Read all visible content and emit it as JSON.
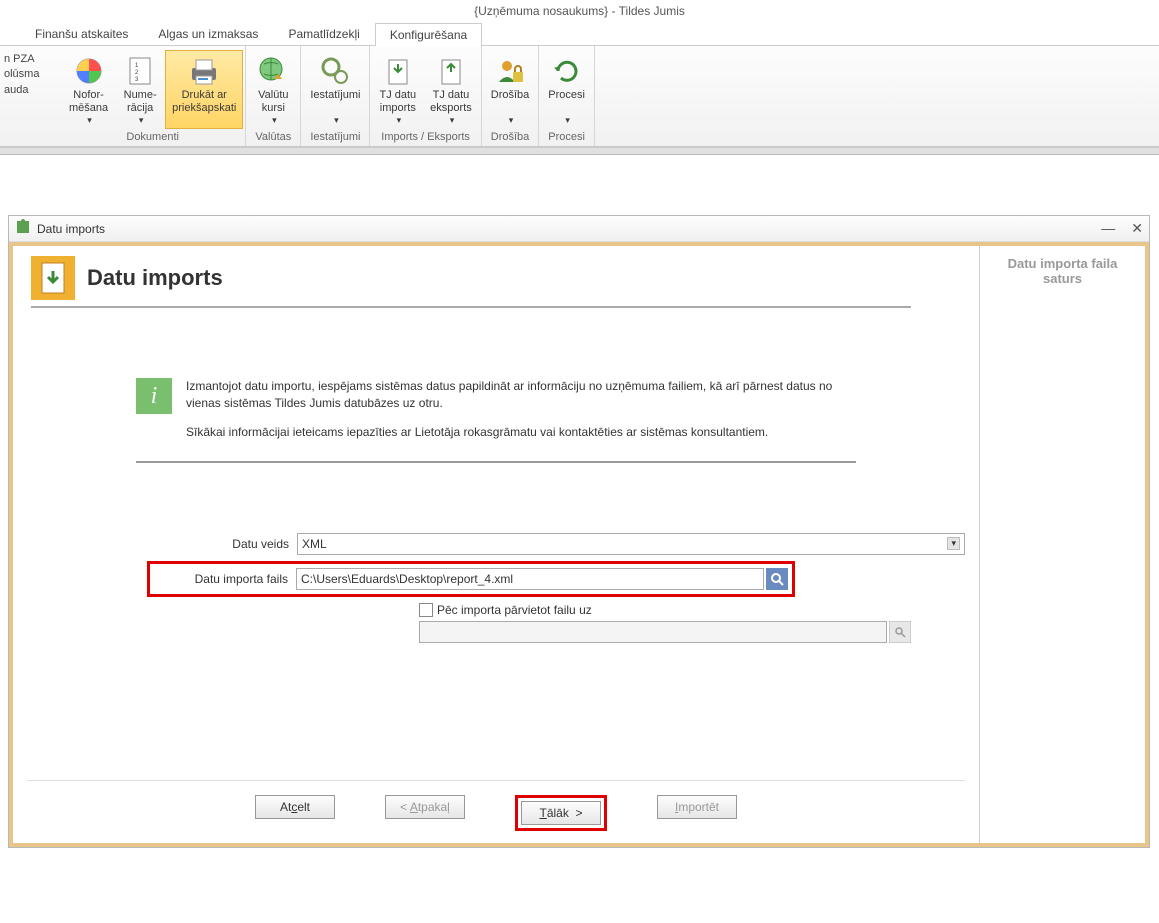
{
  "window": {
    "title": "{Uzņēmuma nosaukums} - Tildes Jumis"
  },
  "tabs": {
    "t1": "Finanšu atskaites",
    "t2": "Algas un izmaksas",
    "t3": "Pamatlīdzekļi",
    "t4": "Konfigurēšana"
  },
  "left_sidebar": {
    "l1": "n PZA",
    "l2": "olūsma",
    "l3": "auda"
  },
  "ribbon": {
    "noformesana": "Nofor-\nmēšana",
    "numeracija": "Nume-\nrācija",
    "drukat": "Drukāt ar\npriekšapskati",
    "grp_dokumenti": "Dokumenti",
    "valutu": "Valūtu\nkursi",
    "grp_valutas": "Valūtas",
    "iestatijumi": "Iestatījumi",
    "grp_iestatijumi": "Iestatījumi",
    "tj_imports": "TJ datu\nimports",
    "tj_eksports": "TJ datu\neksports",
    "grp_impexp": "Imports / Eksports",
    "drosiba": "Drošība",
    "grp_drosiba": "Drošība",
    "procesi": "Procesi",
    "grp_procesi": "Procesi"
  },
  "dialog": {
    "title": "Datu imports",
    "page_title": "Datu imports",
    "right_title": "Datu importa faila saturs",
    "info1": "Izmantojot datu importu, iespējams sistēmas datus papildināt ar informāciju no uzņēmuma failiem, kā arī pārnest datus no vienas sistēmas Tildes Jumis datubāzes uz otru.",
    "info2": "Sīkākai informācijai ieteicams iepazīties ar Lietotāja rokasgrāmatu vai kontaktēties ar sistēmas konsultantiem.",
    "label_datu_veids": "Datu veids",
    "value_datu_veids": "XML",
    "label_importa_fails": "Datu importa fails",
    "value_importa_fails": "C:\\Users\\Eduards\\Desktop\\report_4.xml",
    "checkbox_label": "Pēc importa pārvietot failu uz",
    "btn_atcelt": "Atcelt",
    "btn_atpakal": "< Atpakaļ",
    "btn_talak": "Tālāk  >",
    "btn_importet": "Importēt"
  }
}
